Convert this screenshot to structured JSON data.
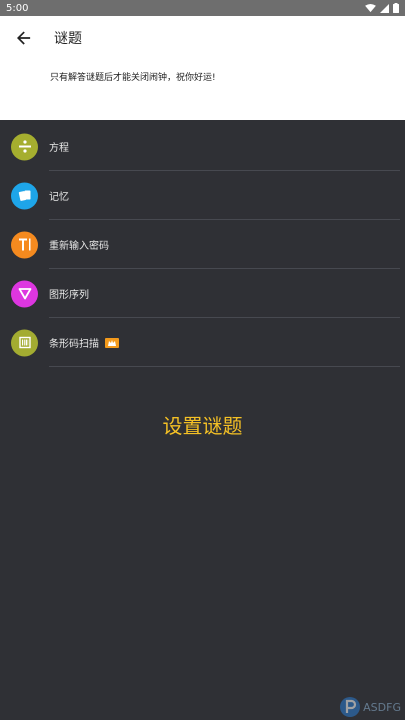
{
  "status_bar": {
    "time": "5:00",
    "icons": [
      "wifi-icon",
      "signal-icon",
      "battery-icon"
    ]
  },
  "app_bar": {
    "title": "谜题",
    "back_icon": "arrow-left-icon"
  },
  "description": "只有解答谜题后才能关闭闹钟，祝你好运!",
  "puzzles": [
    {
      "label": "方程",
      "icon": "divide-icon",
      "color": "#a5ae2f"
    },
    {
      "label": "记忆",
      "icon": "cards-icon",
      "color": "#1ea5e9"
    },
    {
      "label": "重新输入密码",
      "icon": "text-cursor-icon",
      "color": "#f58a1f"
    },
    {
      "label": "图形序列",
      "icon": "triangle-down-icon",
      "color": "#dd36e0"
    },
    {
      "label": "条形码扫描",
      "icon": "barcode-scan-icon",
      "color": "#a3ac31",
      "badge": "pro-badge-icon"
    }
  ],
  "set_puzzle_label": "设置谜题",
  "watermark": {
    "text": "ASDFG",
    "icon": "logo-p-icon"
  },
  "colors": {
    "background": "#2f3035",
    "accent": "#f4c025",
    "badge": "#f39a1c"
  }
}
